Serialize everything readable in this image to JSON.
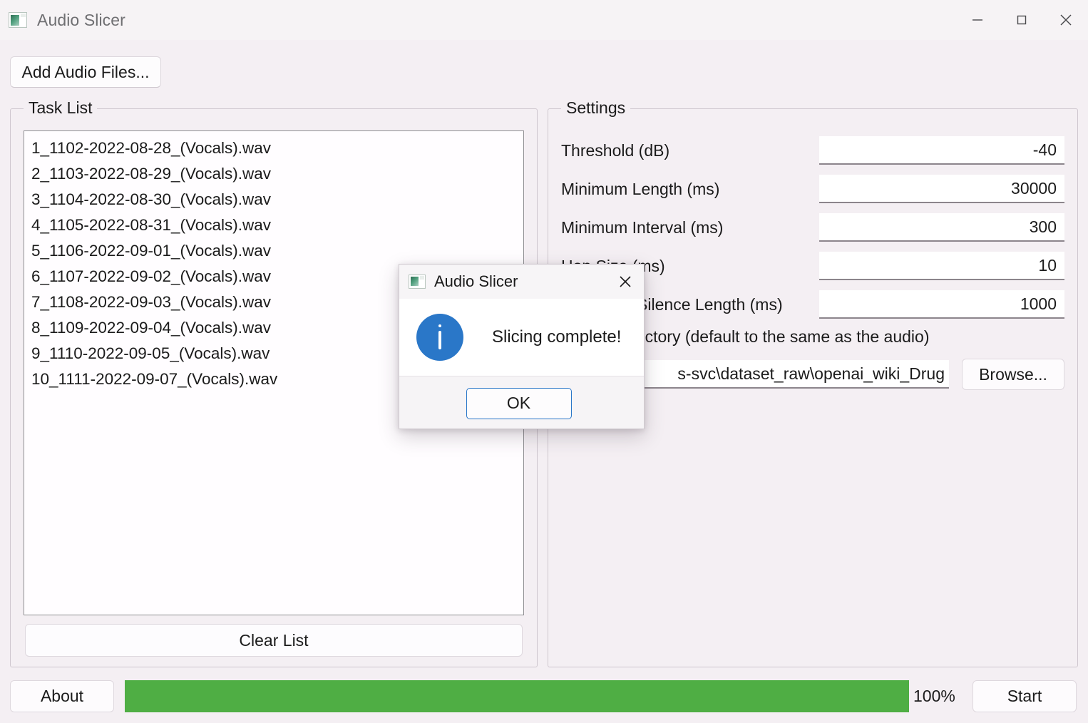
{
  "window": {
    "title": "Audio Slicer",
    "icon": "app-window-icon",
    "background_color": "#f4eff3",
    "controls": {
      "minimize": "minimize-icon",
      "maximize": "maximize-icon",
      "close": "close-icon"
    }
  },
  "toolbar": {
    "add_files_label": "Add Audio Files..."
  },
  "task_panel": {
    "title": "Task List",
    "files": [
      "1_1102-2022-08-28_(Vocals).wav",
      "2_1103-2022-08-29_(Vocals).wav",
      "3_1104-2022-08-30_(Vocals).wav",
      "4_1105-2022-08-31_(Vocals).wav",
      "5_1106-2022-09-01_(Vocals).wav",
      "6_1107-2022-09-02_(Vocals).wav",
      "7_1108-2022-09-03_(Vocals).wav",
      "8_1109-2022-09-04_(Vocals).wav",
      "9_1110-2022-09-05_(Vocals).wav",
      "10_1111-2022-09-07_(Vocals).wav"
    ],
    "clear_label": "Clear List"
  },
  "settings_panel": {
    "title": "Settings",
    "rows": [
      {
        "label": "Threshold (dB)",
        "value": "-40"
      },
      {
        "label": "Minimum Length (ms)",
        "value": "30000"
      },
      {
        "label": "Minimum Interval (ms)",
        "value": "300"
      },
      {
        "label": "Hop Size (ms)",
        "value": "10"
      },
      {
        "label": "Maximum Silence Length (ms)",
        "value": "1000"
      }
    ],
    "output_dir_label": "Output Directory (default to the same as the audio)",
    "output_dir_value": "s-svc\\dataset_raw\\openai_wiki_Drug",
    "browse_label": "Browse..."
  },
  "statusbar": {
    "about_label": "About",
    "progress_percent_label": "100%",
    "progress_value": 100,
    "progress_color": "#4fae44",
    "start_label": "Start"
  },
  "dialog": {
    "title": "Audio Slicer",
    "icon": "app-window-icon",
    "close_icon": "close-icon",
    "info_icon": "info-icon",
    "message": "Slicing complete!",
    "ok_label": "OK"
  }
}
